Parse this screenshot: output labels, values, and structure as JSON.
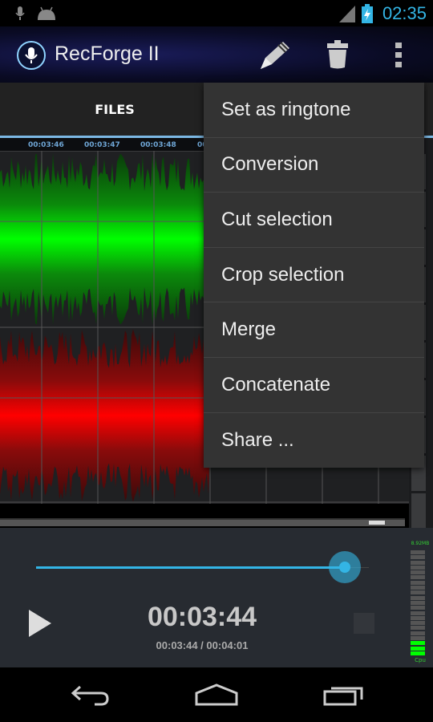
{
  "status_bar": {
    "time": "02:35",
    "icons": [
      "mic-icon",
      "android-icon",
      "signal-icon",
      "battery-charging-icon"
    ]
  },
  "action_bar": {
    "title": "RecForge II",
    "actions": [
      "pencil-icon",
      "trash-icon",
      "overflow-menu-icon"
    ]
  },
  "tabs": [
    {
      "label": "FILES",
      "selected": false
    }
  ],
  "timeline": {
    "labels": [
      "00:03:46",
      "00:03:47",
      "00:03:48",
      "00"
    ]
  },
  "menu": {
    "items": [
      "Set as ringtone",
      "Conversion",
      "Cut selection",
      "Crop selection",
      "Merge",
      "Concatenate",
      "Share ..."
    ]
  },
  "player": {
    "current_time": "00:03:44",
    "progress_text": "00:03:44 / 00:04:01",
    "progress": 0.93
  },
  "meter": {
    "memory": "8.92MB",
    "cpu_label": "Cpu"
  },
  "colors": {
    "accent": "#33b5e5",
    "left_channel": "#00ff00",
    "right_channel": "#ff0000"
  }
}
